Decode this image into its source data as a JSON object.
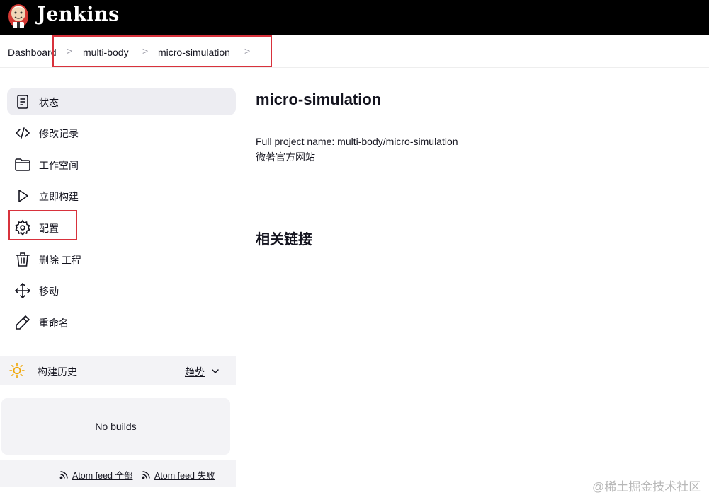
{
  "header": {
    "brand": "Jenkins",
    "logo_icon": "jenkins-butler-logo",
    "bg_color": "#000000"
  },
  "breadcrumb": {
    "items": [
      "Dashboard",
      "multi-body",
      "micro-simulation"
    ],
    "separator": ">"
  },
  "sidebar": {
    "items": [
      {
        "label": "状态",
        "icon": "notepad-icon",
        "active": true
      },
      {
        "label": "修改记录",
        "icon": "code-icon"
      },
      {
        "label": "工作空间",
        "icon": "folder-icon"
      },
      {
        "label": "立即构建",
        "icon": "play-icon"
      },
      {
        "label": "配置",
        "icon": "gear-icon"
      },
      {
        "label": "删除 工程",
        "icon": "trash-icon"
      },
      {
        "label": "移动",
        "icon": "move-icon"
      },
      {
        "label": "重命名",
        "icon": "pencil-icon"
      }
    ]
  },
  "build_history": {
    "title": "构建历史",
    "trend_label": "趋势",
    "empty_text": "No builds",
    "feeds": [
      "Atom feed 全部",
      "Atom feed 失败"
    ]
  },
  "main": {
    "title": "micro-simulation",
    "full_name": "Full project name: multi-body/micro-simulation",
    "description": "微著官方网站",
    "related_links_title": "相关链接"
  },
  "watermark": "@稀土掘金技术社区",
  "colors": {
    "highlight": "#d8323c",
    "active_item": "#ededf2",
    "panel": "#f3f3f6",
    "sun": "#f0a500"
  }
}
